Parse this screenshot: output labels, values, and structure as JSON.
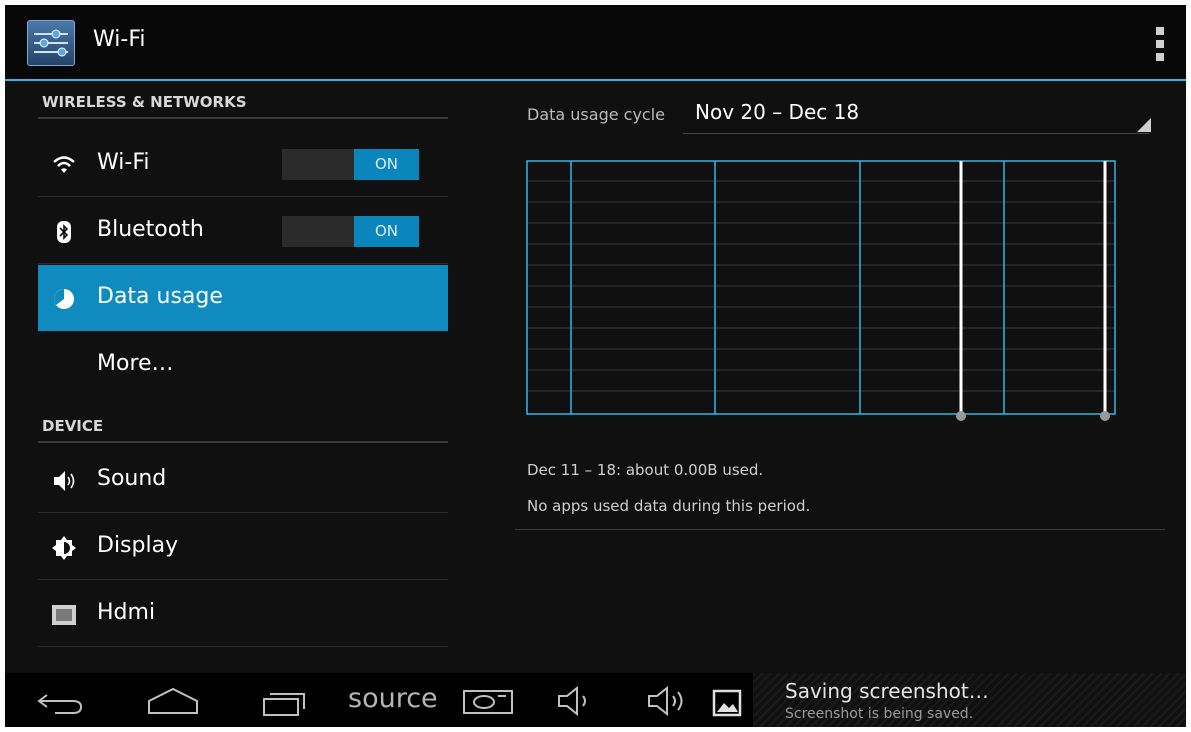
{
  "action_bar": {
    "title": "Wi-Fi",
    "icon": "settings-sliders-icon",
    "menu_icon": "overflow-menu-icon"
  },
  "sidebar": {
    "sections": [
      {
        "header": "WIRELESS & NETWORKS",
        "items": [
          {
            "label": "Wi-Fi",
            "icon": "wifi-icon",
            "toggle": "ON"
          },
          {
            "label": "Bluetooth",
            "icon": "bluetooth-icon",
            "toggle": "ON"
          },
          {
            "label": "Data usage",
            "icon": "data-usage-icon",
            "selected": true
          },
          {
            "label": "More…",
            "icon": ""
          }
        ]
      },
      {
        "header": "DEVICE",
        "items": [
          {
            "label": "Sound",
            "icon": "speaker-icon"
          },
          {
            "label": "Display",
            "icon": "brightness-icon"
          },
          {
            "label": "Hdmi",
            "icon": "hdmi-icon"
          }
        ]
      }
    ]
  },
  "main": {
    "cycle_label": "Data usage cycle",
    "cycle_value": "Nov 20 – Dec 18",
    "usage_text": "Dec 11 – 18: about 0.00B used.",
    "no_apps_text": "No apps used data during this period."
  },
  "nav_bar": {
    "source_label": "source",
    "buttons": [
      "back-icon",
      "home-icon",
      "recent-apps-icon",
      "screenshot-icon",
      "volume-down-icon",
      "volume-up-icon"
    ]
  },
  "notification": {
    "icon": "image-icon",
    "title": "Saving screenshot…",
    "subtitle": "Screenshot is being saved."
  },
  "colors": {
    "accent": "#33b5e5",
    "selected": "#0f8bc0",
    "toggle_on": "#0a86bd",
    "background": "#101010"
  }
}
